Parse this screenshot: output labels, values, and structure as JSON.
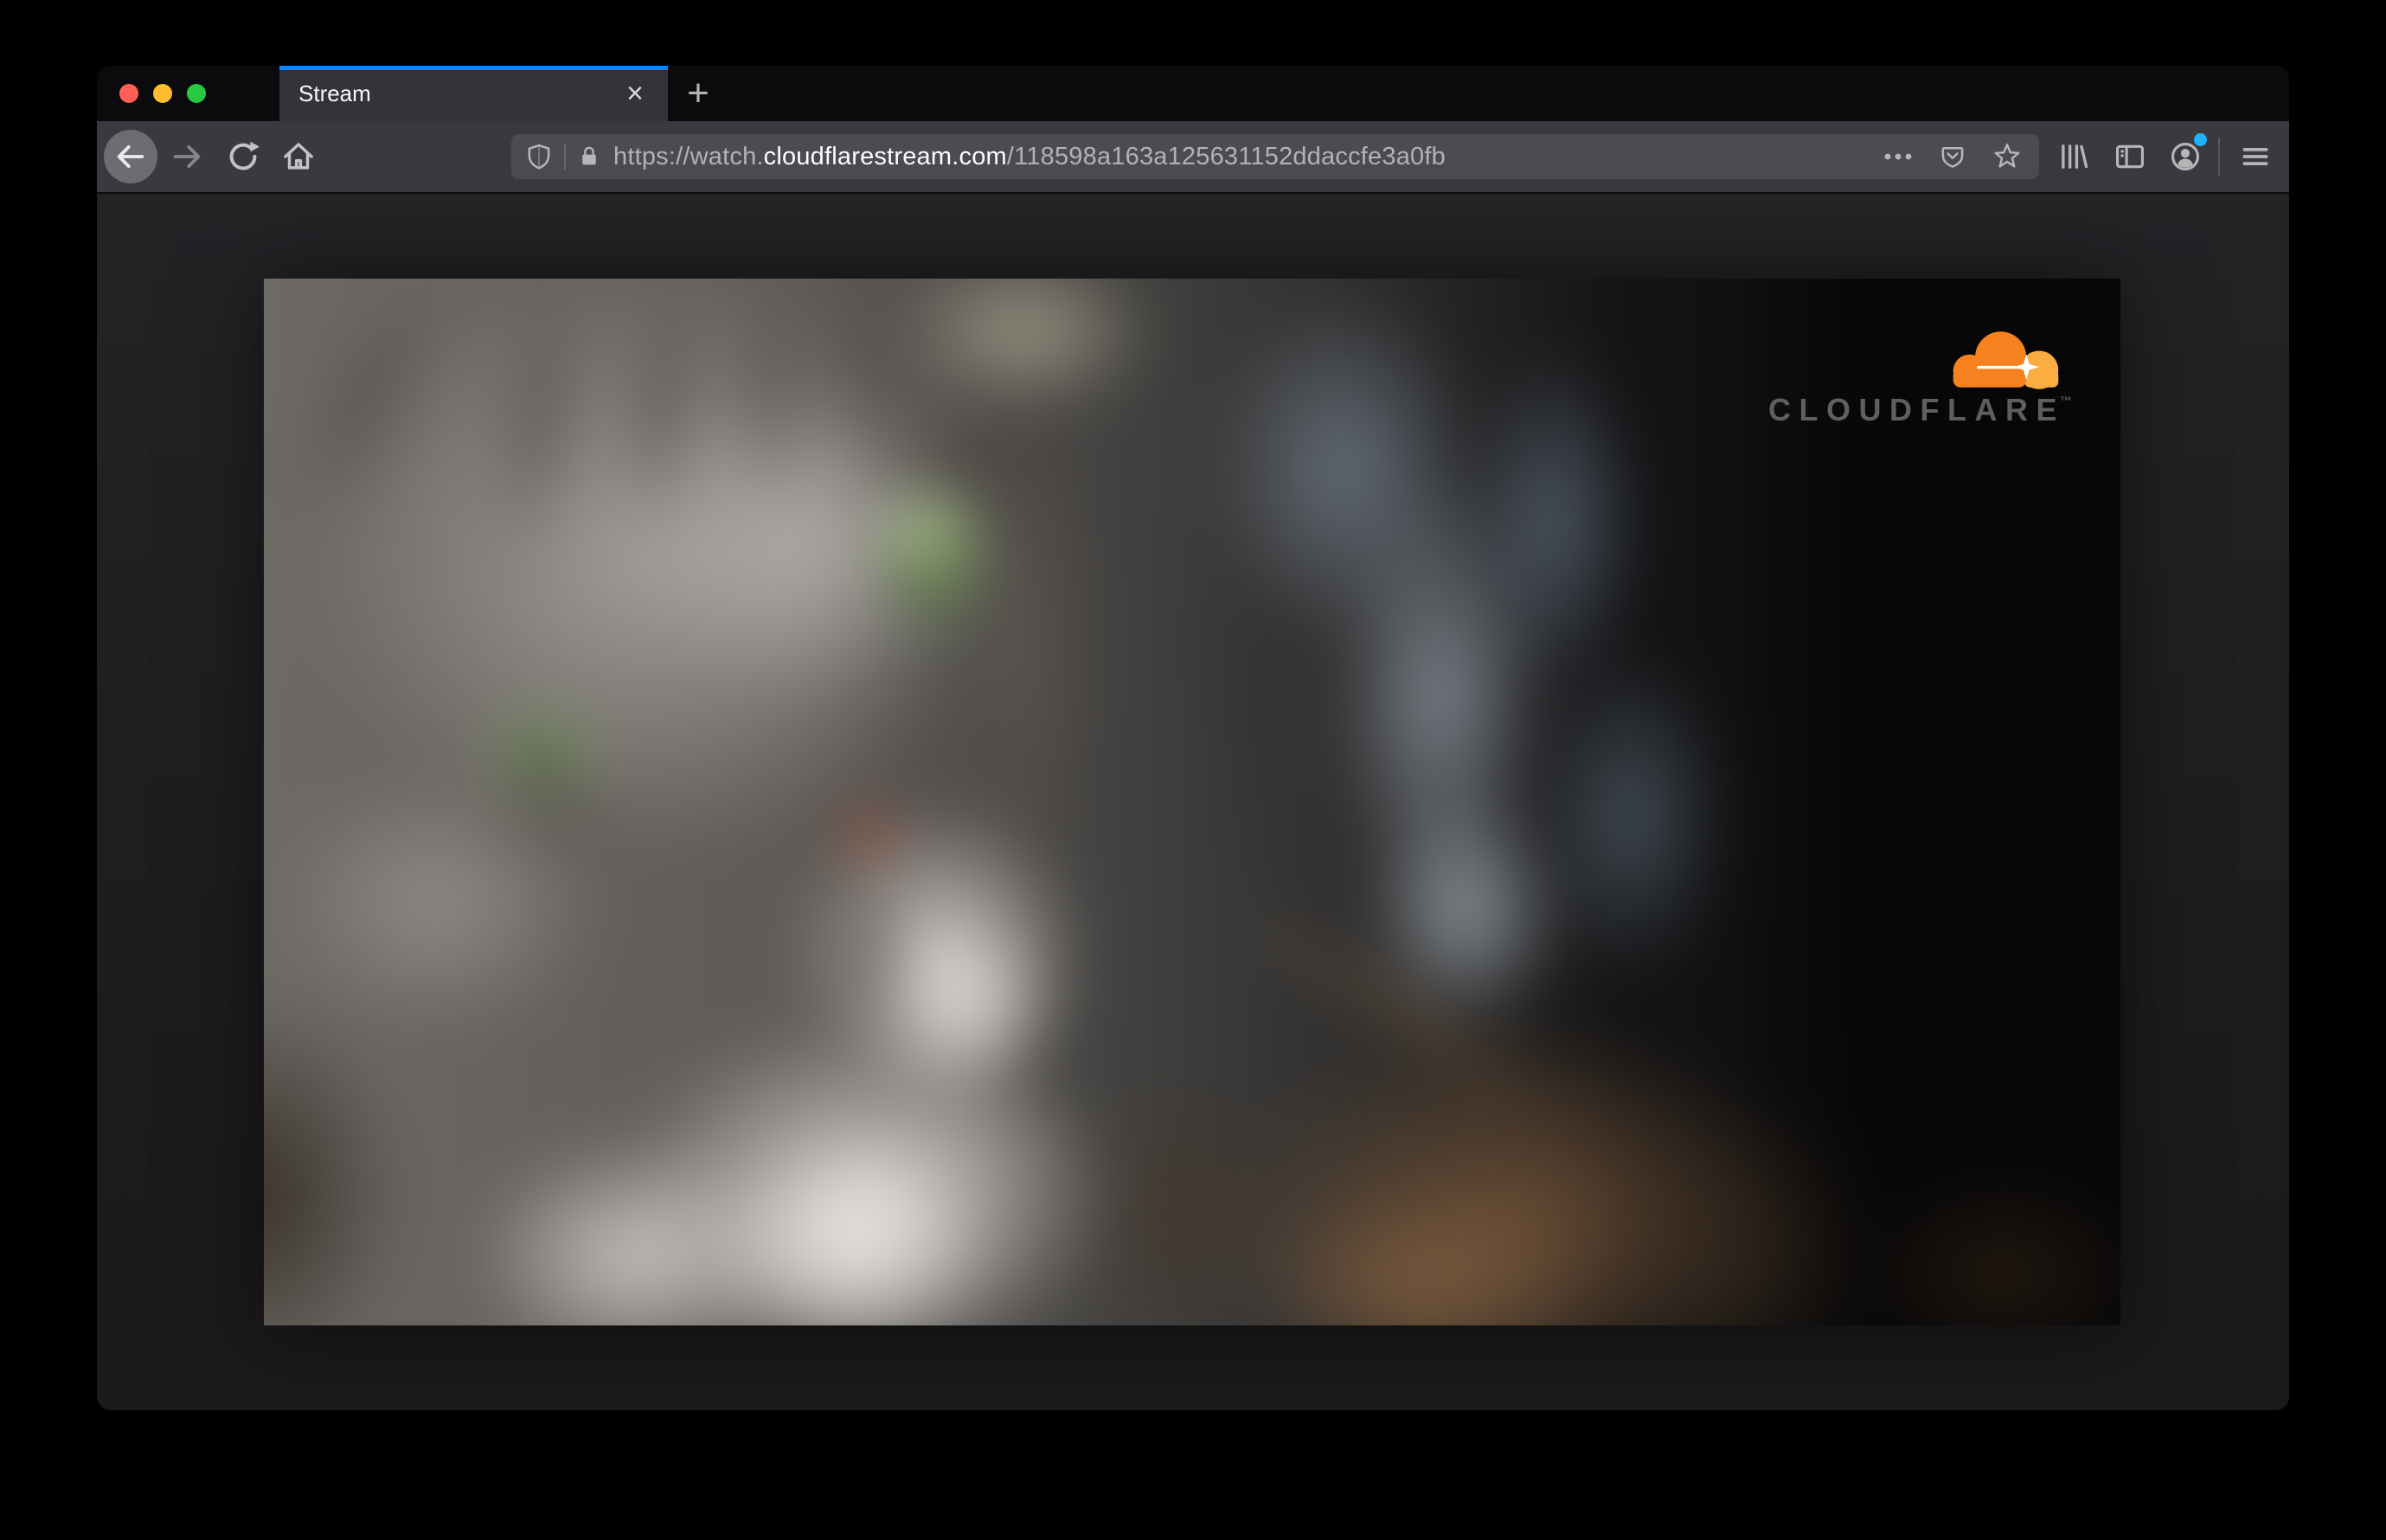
{
  "tab": {
    "title": "Stream",
    "close_glyph": "×",
    "new_tab_glyph": "+"
  },
  "urlbar": {
    "url_prefix": "https://watch.",
    "url_domain": "cloudflarestream.com",
    "url_path": "/118598a163a125631152ddaccfe3a0fb"
  },
  "video": {
    "brand_name": "CLOUDFLARE",
    "brand_trademark": "™"
  },
  "colors": {
    "tab_accent_blue": "#0a84ff",
    "cloudflare_orange": "#f6821f",
    "cloudflare_orange_light": "#fbad41",
    "cloudflare_wordmark_grey": "#5d5f63",
    "traffic_red": "#ff5f57",
    "traffic_yellow": "#febc2e",
    "traffic_green": "#28c840",
    "notification_dot_blue": "#1fb3fd",
    "toolbar_bg": "#3a3a3e",
    "urlbar_bg": "#4b4b51",
    "tabstrip_bg": "#0b0b0d"
  }
}
